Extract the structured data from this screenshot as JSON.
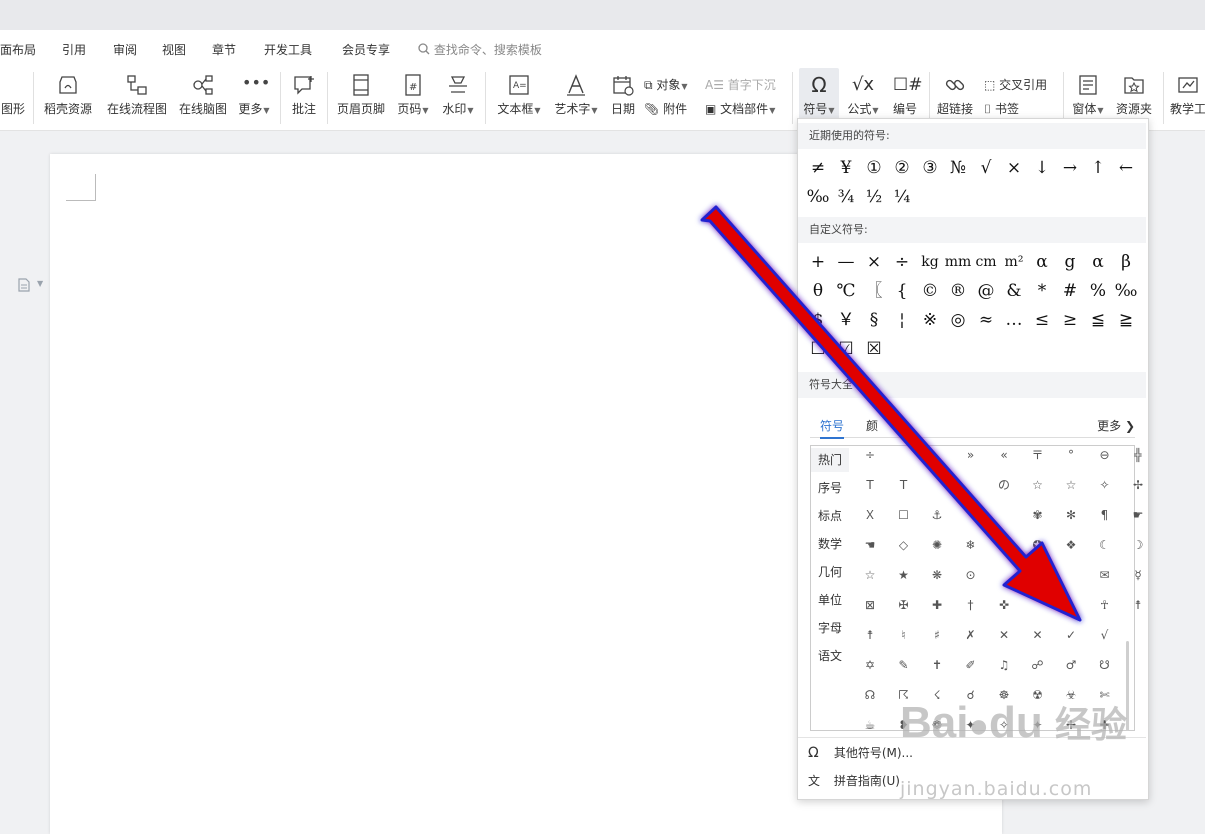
{
  "menubar": {
    "items": [
      "面布局",
      "引用",
      "审阅",
      "视图",
      "章节",
      "开发工具",
      "会员专享"
    ],
    "search_placeholder": "查找命令、搜索模板"
  },
  "ribbon": {
    "shape_label": "图形",
    "shell_assets": "稻壳资源",
    "flowchart": "在线流程图",
    "mindmap": "在线脑图",
    "more": "更多",
    "comment": "批注",
    "header_footer": "页眉页脚",
    "page_num": "页码",
    "watermark": "水印",
    "textbox": "文本框",
    "wordart": "艺术字",
    "date": "日期",
    "object": "对象",
    "attachment": "附件",
    "dropcap": "首字下沉",
    "doc_parts": "文档部件",
    "symbol": "符号",
    "formula": "公式",
    "numbering": "编号",
    "hyperlink": "超链接",
    "cross_ref": "交叉引用",
    "bookmark": "书签",
    "form": "窗体",
    "resource": "资源夹",
    "teaching": "教学工"
  },
  "symbol_panel": {
    "recent_title": "近期使用的符号:",
    "recent": [
      "≠",
      "¥",
      "①",
      "②",
      "③",
      "№",
      "√",
      "×",
      "↓",
      "→",
      "↑",
      "←",
      "‰",
      "¾",
      "½",
      "¼"
    ],
    "custom_title": "自定义符号:",
    "custom": [
      "+",
      "—",
      "×",
      "÷",
      "kg",
      "mm",
      "cm",
      "m²",
      "α",
      "g",
      "α",
      "β",
      "θ",
      "℃",
      "〖",
      "{",
      "©",
      "®",
      "@",
      "&",
      "*",
      "#",
      "%",
      "‰",
      "$",
      "￥",
      "§",
      "¦",
      "※",
      "◎",
      "≈",
      "…",
      "≤",
      "≥",
      "≦",
      "≧",
      "☐",
      "☑",
      "☒"
    ],
    "library_title": "符号大全",
    "tabs": [
      "符号",
      "颜"
    ],
    "more_label": "更多",
    "categories": [
      "热门",
      "序号",
      "标点",
      "数学",
      "几何",
      "单位",
      "字母",
      "语文"
    ],
    "grid": [
      [
        "÷",
        "",
        "",
        "»",
        "«",
        "〒",
        "°",
        "⊖",
        "╬"
      ],
      [
        "T",
        "T",
        "",
        "",
        "の",
        "☆",
        "☆",
        "✧",
        "✢"
      ],
      [
        "Ｘ",
        "☐",
        "⚓",
        "",
        "",
        "✾",
        "✻",
        "¶",
        "☛"
      ],
      [
        "☚",
        "◇",
        "✺",
        "❄",
        "",
        "✪",
        "❖",
        "☾",
        "☽"
      ],
      [
        "☆",
        "★",
        "❋",
        "⊙",
        "",
        "",
        "",
        "✉",
        "☿"
      ],
      [
        "⊠",
        "✠",
        "✚",
        "†",
        "✜",
        "",
        "",
        "☥",
        "☨"
      ],
      [
        "☨",
        "♮",
        "♯",
        "✗",
        "✕",
        "✕",
        "✓",
        "√",
        ""
      ],
      [
        "✡",
        "✎",
        "✝",
        "✐",
        "♫",
        "☍",
        "♂",
        "☋",
        ""
      ],
      [
        "☊",
        "☈",
        "☇",
        "☌",
        "☸",
        "☢",
        "☣",
        "✄",
        ""
      ],
      [
        "☕",
        "❥",
        "❁",
        "✦",
        "✧",
        "✦",
        "✢",
        "✚",
        ""
      ]
    ],
    "other_symbols": "其他符号(M)...",
    "pinyin_guide": "拼音指南(U)"
  },
  "watermark": {
    "brand": "Bai",
    "brand2": "du",
    "brand_cn": "经验",
    "url": "jingyan.baidu.com"
  }
}
